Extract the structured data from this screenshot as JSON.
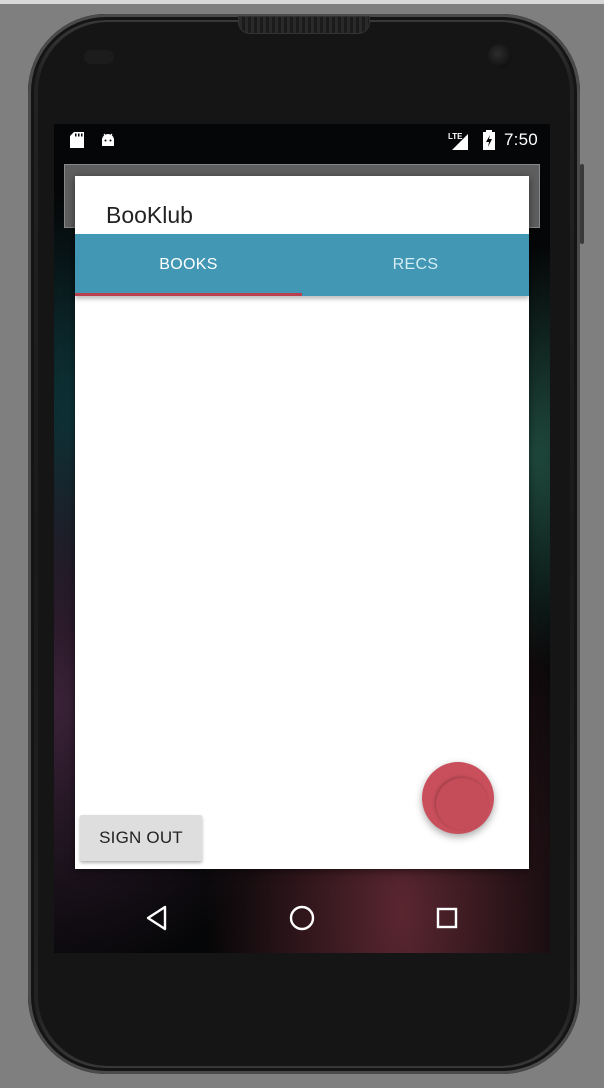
{
  "statusbar": {
    "time": "7:50",
    "network_label": "LTE",
    "icons": [
      "sd-card-icon",
      "android-debug-icon",
      "lte-signal-icon",
      "battery-charging-icon"
    ]
  },
  "app": {
    "title": "BooKlub"
  },
  "tabs": [
    {
      "label": "BOOKS",
      "selected": true
    },
    {
      "label": "RECS",
      "selected": false
    }
  ],
  "buttons": {
    "sign_out_label": "SIGN OUT",
    "fab_icon": "add-fab-icon"
  },
  "navbar": {
    "icons": [
      "back-icon",
      "home-icon",
      "recents-icon"
    ]
  },
  "colors": {
    "tab_bar": "#4298b4",
    "tab_indicator": "#b8404f",
    "fab": "#c94f5c",
    "sign_out_button": "#dedede"
  }
}
